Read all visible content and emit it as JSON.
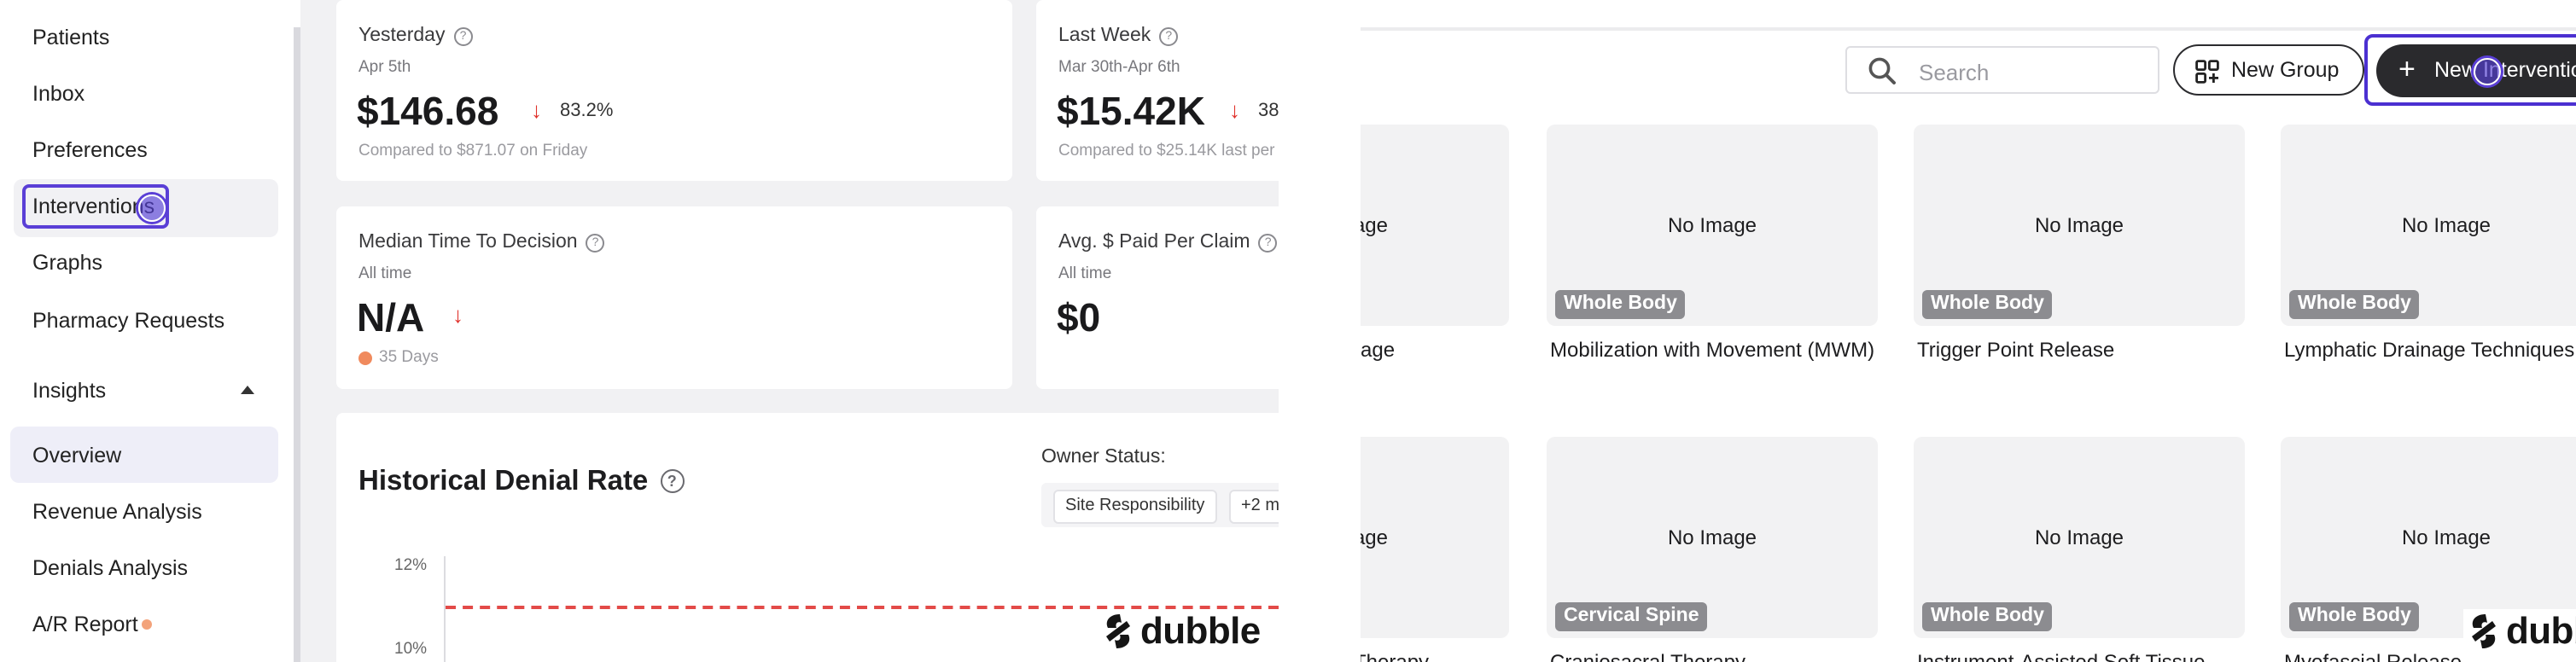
{
  "sidebar": {
    "items": [
      {
        "label": "Patients"
      },
      {
        "label": "Inbox"
      },
      {
        "label": "Preferences"
      },
      {
        "label": "Interventions"
      },
      {
        "label": "Graphs"
      },
      {
        "label": "Pharmacy Requests"
      }
    ],
    "insights": {
      "label": "Insights",
      "subitems": [
        {
          "label": "Overview"
        },
        {
          "label": "Revenue Analysis"
        },
        {
          "label": "Denials Analysis"
        },
        {
          "label": "A/R Report"
        }
      ]
    }
  },
  "dashboard": {
    "cards": [
      {
        "title": "Yesterday",
        "date": "Apr 5th",
        "value": "$146.68",
        "change": "83.2%",
        "comparison": "Compared to $871.07 on Friday"
      },
      {
        "title": "Last Week",
        "date": "Mar 30th-Apr 6th",
        "value": "$15.42K",
        "change": "38",
        "comparison": "Compared to $25.14K last per"
      },
      {
        "title": "Median Time To Decision",
        "period": "All time",
        "value": "N/A",
        "footnote": "35 Days"
      },
      {
        "title": "Avg. $ Paid Per Claim",
        "period": "All time",
        "value": "$0"
      }
    ],
    "chart": {
      "title": "Historical Denial Rate",
      "owner_status_label": "Owner Status:",
      "filters": [
        "Site Responsibility",
        "+2 m"
      ],
      "y_ticks": [
        "12%",
        "10%"
      ]
    }
  },
  "logo": {
    "text": "dubble"
  },
  "interventions": {
    "search_placeholder": "Search",
    "new_group_label": "New Group",
    "new_intervention_label": "New Intervention",
    "no_image_text": "No Image",
    "partial_row1": {
      "tile_text": "age",
      "name": "age"
    },
    "partial_row2": {
      "tile_text": "age",
      "name": "Therapy"
    },
    "row1": [
      {
        "tag": "Whole Body",
        "name": "Mobilization with Movement (MWM)"
      },
      {
        "tag": "Whole Body",
        "name": "Trigger Point Release"
      },
      {
        "tag": "Whole Body",
        "name": "Lymphatic Drainage Techniques"
      }
    ],
    "row2": [
      {
        "tag": "Cervical Spine",
        "name": "Craniosacral Therapy"
      },
      {
        "tag": "Whole Body",
        "name": "Instrument-Assisted Soft Tissue"
      },
      {
        "tag": "Whole Body",
        "name": "Myofascial Release"
      }
    ]
  }
}
